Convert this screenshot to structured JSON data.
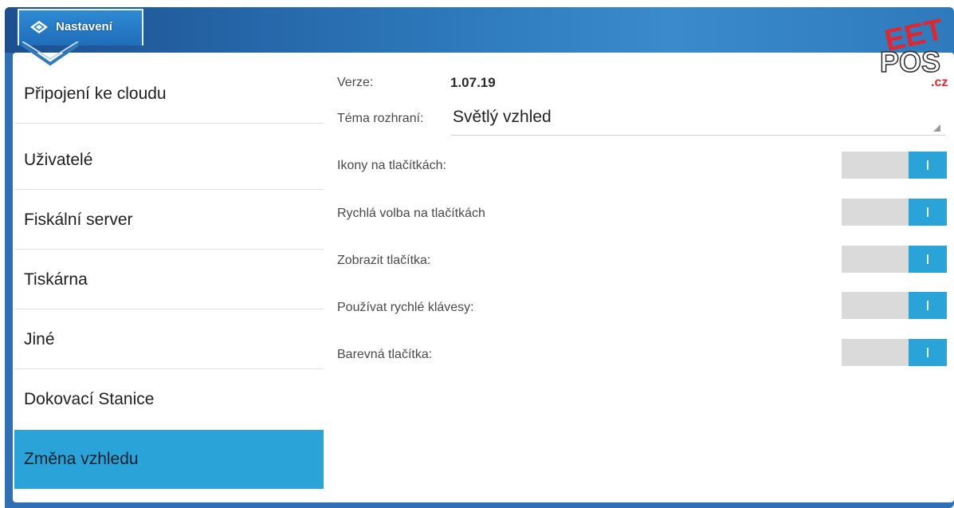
{
  "header": {
    "tab_label": "Nastavení",
    "logo": {
      "line1": "EET",
      "line2": "POS",
      "line3": ".cz"
    }
  },
  "sidebar": {
    "items": [
      {
        "label": "Připojení ke cloudu"
      },
      {
        "label": "Uživatelé"
      },
      {
        "label": "Fiskální server"
      },
      {
        "label": "Tiskárna"
      },
      {
        "label": "Jiné"
      },
      {
        "label": "Dokovací Stanice"
      },
      {
        "label": "Změna vzhledu"
      }
    ],
    "active_index": 6
  },
  "settings": {
    "version_label": "Verze:",
    "version_value": "1.07.19",
    "theme_label": "Téma rozhraní:",
    "theme_value": "Světlý vzhled",
    "toggles": [
      {
        "label": "Ikony na tlačítkách:",
        "state": "on"
      },
      {
        "label": "Rychlá volba na tlačítkách",
        "state": "on"
      },
      {
        "label": "Zobrazit tlačítka:",
        "state": "on"
      },
      {
        "label": "Používat rychlé klávesy:",
        "state": "on"
      },
      {
        "label": "Barevná tlačítka:",
        "state": "on"
      }
    ]
  },
  "colors": {
    "accent": "#2aa3d8",
    "header": "#2a73b5",
    "logo_red": "#e3262e"
  }
}
